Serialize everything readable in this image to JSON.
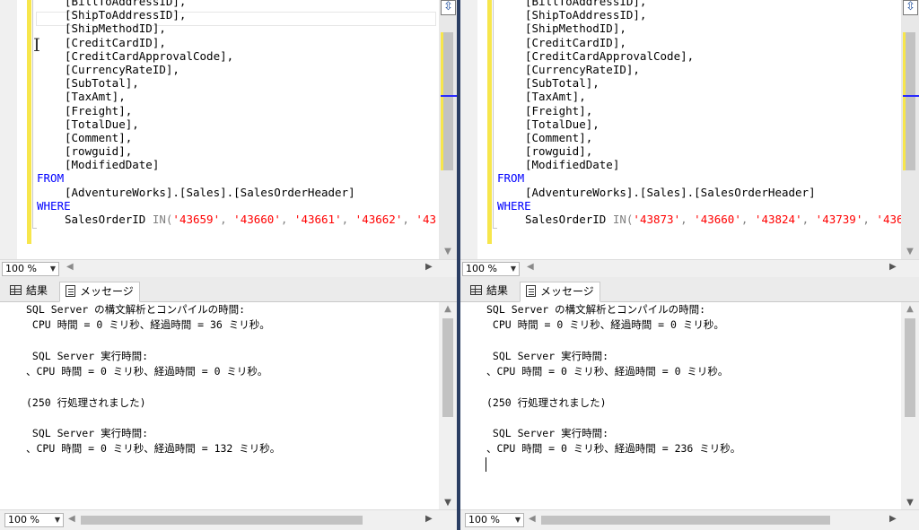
{
  "left": {
    "column_list": [
      "[BillToAddressID],",
      "[ShipToAddressID],",
      "[ShipMethodID],",
      "[CreditCardID],",
      "[CreditCardApprovalCode],",
      "[CurrencyRateID],",
      "[SubTotal],",
      "[TaxAmt],",
      "[Freight],",
      "[TotalDue],",
      "[Comment],",
      "[rowguid],",
      "[ModifiedDate]"
    ],
    "from_keyword": "FROM",
    "table_ref": "[AdventureWorks].[Sales].[SalesOrderHeader]",
    "where_keyword": "WHERE",
    "where_column": "SalesOrderID ",
    "in_keyword": "IN(",
    "in_values": [
      "'43659'",
      "'43660'",
      "'43661'",
      "'43662'",
      "'43"
    ],
    "editor_zoom": "100 %",
    "results_tab": "結果",
    "messages_tab": "メッセージ",
    "messages": [
      "SQL Server の構文解析とコンパイルの時間:",
      " CPU 時間 = 0 ミリ秒、経過時間 = 36 ミリ秒。",
      "",
      " SQL Server 実行時間:",
      "、CPU 時間 = 0 ミリ秒、経過時間 = 0 ミリ秒。",
      "",
      "(250 行処理されました)",
      "",
      " SQL Server 実行時間:",
      "、CPU 時間 = 0 ミリ秒、経過時間 = 132 ミリ秒。"
    ],
    "messages_zoom": "100 %"
  },
  "right": {
    "column_list": [
      "[BillToAddressID],",
      "[ShipToAddressID],",
      "[ShipMethodID],",
      "[CreditCardID],",
      "[CreditCardApprovalCode],",
      "[CurrencyRateID],",
      "[SubTotal],",
      "[TaxAmt],",
      "[Freight],",
      "[TotalDue],",
      "[Comment],",
      "[rowguid],",
      "[ModifiedDate]"
    ],
    "from_keyword": "FROM",
    "table_ref": "[AdventureWorks].[Sales].[SalesOrderHeader]",
    "where_keyword": "WHERE",
    "where_column": "SalesOrderID ",
    "in_keyword": "IN(",
    "in_values": [
      "'43873'",
      "'43660'",
      "'43824'",
      "'43739'",
      "'436"
    ],
    "editor_zoom": "100 %",
    "results_tab": "結果",
    "messages_tab": "メッセージ",
    "messages": [
      "SQL Server の構文解析とコンパイルの時間:",
      " CPU 時間 = 0 ミリ秒、経過時間 = 0 ミリ秒。",
      "",
      " SQL Server 実行時間:",
      "、CPU 時間 = 0 ミリ秒、経過時間 = 0 ミリ秒。",
      "",
      "(250 行処理されました)",
      "",
      " SQL Server 実行時間:",
      "、CPU 時間 = 0 ミリ秒、経過時間 = 236 ミリ秒。"
    ],
    "messages_zoom": "100 %"
  },
  "icons": {
    "split": "split-view-icon",
    "results": "grid-icon",
    "messages": "message-icon",
    "text_cursor": "ibeam-cursor-icon"
  },
  "colors": {
    "keyword": "#0000ff",
    "string": "#ff0000",
    "change_bar": "#f7e64c",
    "splitter": "#2b3e63"
  }
}
